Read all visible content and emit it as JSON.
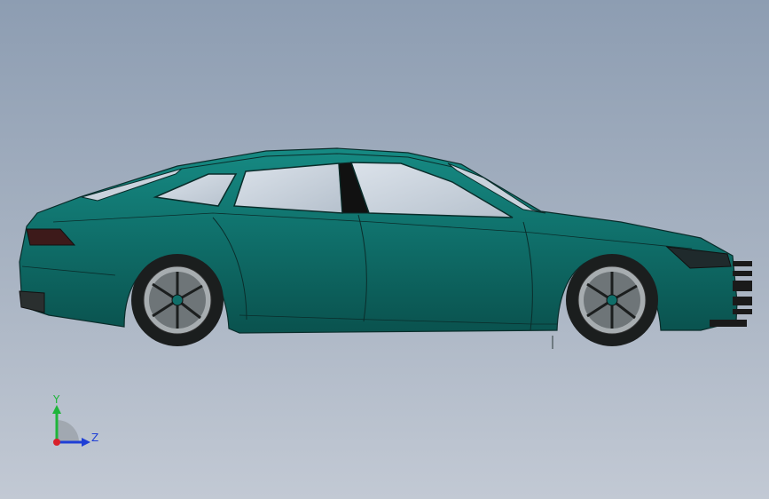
{
  "viewport": {
    "background_top": "#8d9db2",
    "background_bottom": "#c2c9d4"
  },
  "model": {
    "body_color": "#0f6e69",
    "body_shade": "#0b5954",
    "glass_color": "#c9d2dc",
    "tire_color": "#1b1e1e",
    "rim_color": "#a7adb0"
  },
  "triad": {
    "y_label": "Y",
    "z_label": "Z",
    "y_color": "#1eb53a",
    "z_color": "#1f3fd6",
    "x_color": "#d8202a"
  }
}
